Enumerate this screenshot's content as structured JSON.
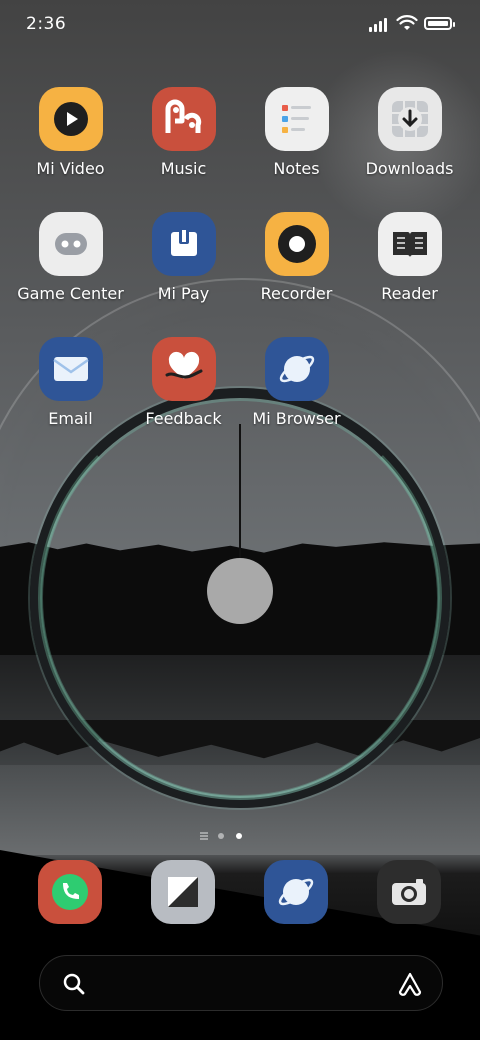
{
  "status_bar": {
    "time": "2:36"
  },
  "apps": [
    {
      "label": "Mi Video",
      "icon": "mi-video-icon",
      "color": "#f6b243"
    },
    {
      "label": "Music",
      "icon": "music-icon",
      "color": "#c9503d"
    },
    {
      "label": "Notes",
      "icon": "notes-icon",
      "color": "#efefef"
    },
    {
      "label": "Downloads",
      "icon": "downloads-icon",
      "color": "#e8e8e8"
    },
    {
      "label": "Game Center",
      "icon": "game-center-icon",
      "color": "#ededed"
    },
    {
      "label": "Mi Pay",
      "icon": "mi-pay-icon",
      "color": "#2f5597"
    },
    {
      "label": "Recorder",
      "icon": "recorder-icon",
      "color": "#f6b243"
    },
    {
      "label": "Reader",
      "icon": "reader-icon",
      "color": "#efefef"
    },
    {
      "label": "Email",
      "icon": "email-icon",
      "color": "#2f5597"
    },
    {
      "label": "Feedback",
      "icon": "feedback-icon",
      "color": "#c9503d"
    },
    {
      "label": "Mi Browser",
      "icon": "mi-browser-icon",
      "color": "#2f5597"
    }
  ],
  "dock": [
    {
      "icon": "phone-icon",
      "color": "#c9503d"
    },
    {
      "icon": "file-manager-icon",
      "color": "#b8bcc2"
    },
    {
      "icon": "mi-browser-icon",
      "color": "#2f5597"
    },
    {
      "icon": "camera-icon",
      "color": "#2d2d2d"
    }
  ],
  "page_indicator": {
    "pages": 2,
    "current": 2
  }
}
